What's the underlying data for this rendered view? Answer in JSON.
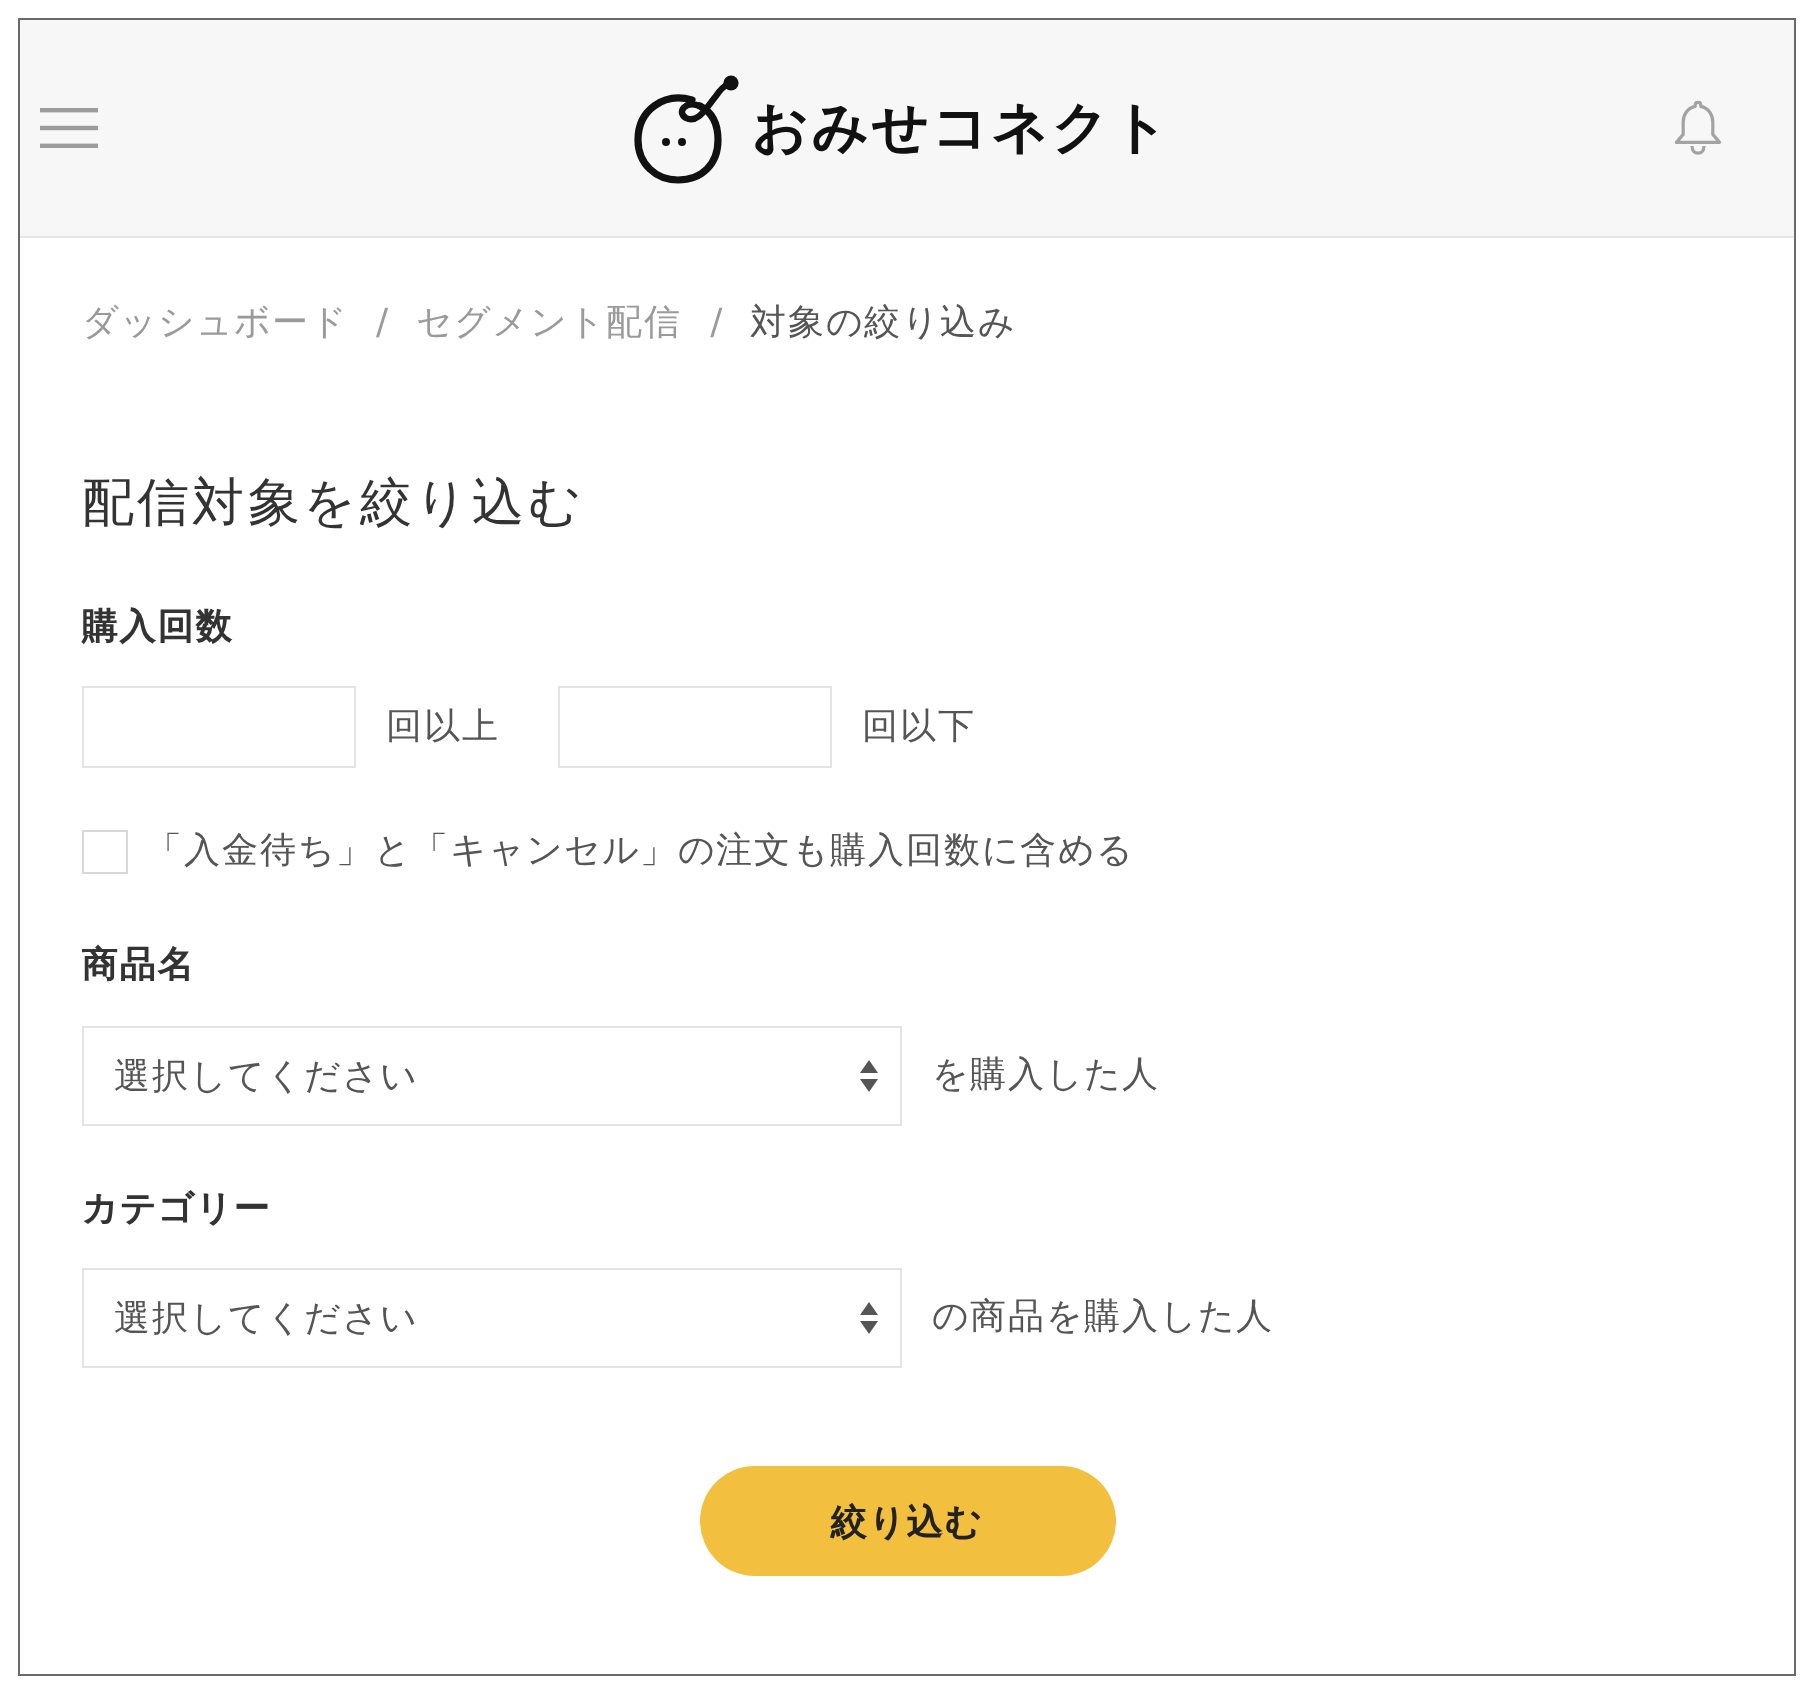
{
  "header": {
    "logo_text": "おみせコネクト"
  },
  "breadcrumb": [
    {
      "kind": "link",
      "label": "ダッシュボード"
    },
    {
      "kind": "separator",
      "label": "/"
    },
    {
      "kind": "link",
      "label": "セグメント配信"
    },
    {
      "kind": "separator",
      "label": "/"
    },
    {
      "kind": "current",
      "label": "対象の絞り込み"
    }
  ],
  "title": "配信対象を絞り込む",
  "purchase_count": {
    "label": "購入回数",
    "ranges": [
      {
        "suffix": "回以上"
      },
      {
        "suffix": "回以下"
      }
    ],
    "include_option": {
      "label": "「入金待ち」と「キャンセル」の注文も購入回数に含める",
      "checked": false
    }
  },
  "filters": [
    {
      "label": "商品名",
      "placeholder": "選択してください",
      "suffix": "を購入した人"
    },
    {
      "label": "カテゴリー",
      "placeholder": "選択してください",
      "suffix": "の商品を購入した人"
    }
  ],
  "submit_button": {
    "label": "絞り込む"
  }
}
